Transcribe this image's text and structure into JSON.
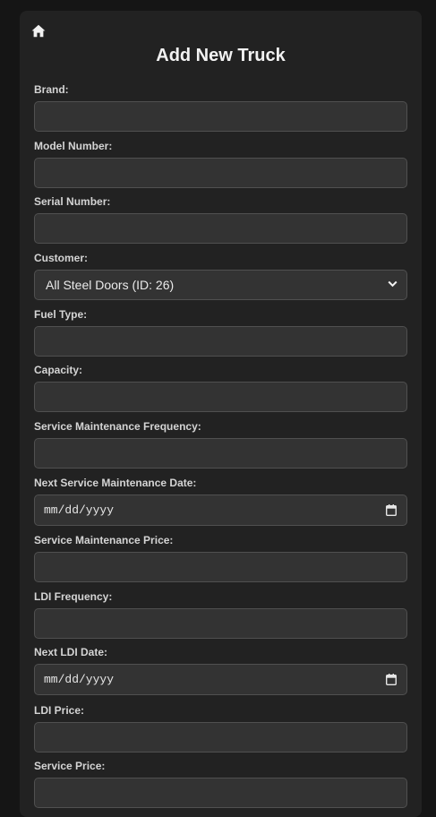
{
  "header": {
    "home_icon": "home-icon",
    "title": "Add New Truck"
  },
  "form": {
    "brand": {
      "label": "Brand:",
      "value": ""
    },
    "model_number": {
      "label": "Model Number:",
      "value": ""
    },
    "serial_number": {
      "label": "Serial Number:",
      "value": ""
    },
    "customer": {
      "label": "Customer:",
      "value": "All Steel Doors (ID: 26)",
      "icon": "chevron-down-icon"
    },
    "fuel_type": {
      "label": "Fuel Type:",
      "value": ""
    },
    "capacity": {
      "label": "Capacity:",
      "value": ""
    },
    "service_maintenance_frequency": {
      "label": "Service Maintenance Frequency:",
      "value": ""
    },
    "next_service_maintenance_date": {
      "label": "Next Service Maintenance Date:",
      "placeholder": "mm/dd/yyyy",
      "icon": "calendar-icon"
    },
    "service_maintenance_price": {
      "label": "Service Maintenance Price:",
      "value": ""
    },
    "ldi_frequency": {
      "label": "LDI Frequency:",
      "value": ""
    },
    "next_ldi_date": {
      "label": "Next LDI Date:",
      "placeholder": "mm/dd/yyyy",
      "icon": "calendar-icon"
    },
    "ldi_price": {
      "label": "LDI Price:",
      "value": ""
    },
    "service_price": {
      "label": "Service Price:",
      "value": ""
    }
  },
  "colors": {
    "background": "#151515",
    "panel": "#222222",
    "input_bg": "#333333",
    "input_border": "#505050",
    "text": "#e6e6e6"
  }
}
